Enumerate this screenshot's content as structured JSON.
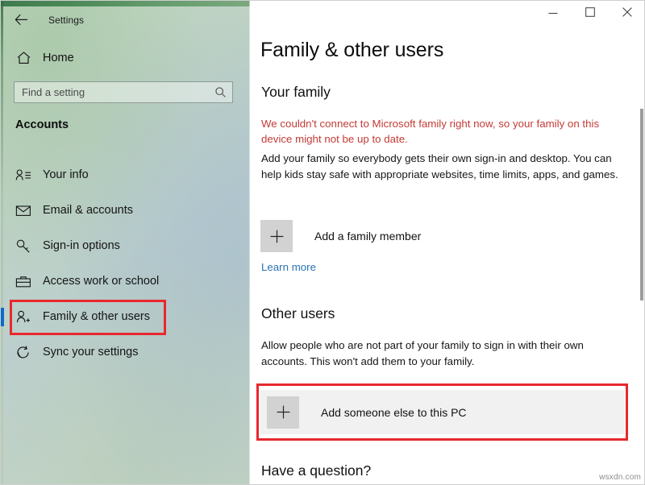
{
  "window": {
    "app_title": "Settings",
    "back_icon": "back-arrow-icon",
    "controls": {
      "minimize": "minimize-icon",
      "maximize": "maximize-icon",
      "close": "close-icon"
    }
  },
  "sidebar": {
    "home": {
      "label": "Home",
      "icon": "home-icon"
    },
    "search": {
      "placeholder": "Find a setting",
      "value": "",
      "icon": "search-icon"
    },
    "section_title": "Accounts",
    "items": [
      {
        "label": "Your info",
        "icon": "person-info-icon",
        "selected": false
      },
      {
        "label": "Email & accounts",
        "icon": "envelope-icon",
        "selected": false
      },
      {
        "label": "Sign-in options",
        "icon": "key-icon",
        "selected": false
      },
      {
        "label": "Access work or school",
        "icon": "briefcase-icon",
        "selected": false
      },
      {
        "label": "Family & other users",
        "icon": "person-add-icon",
        "selected": true
      },
      {
        "label": "Sync your settings",
        "icon": "sync-icon",
        "selected": false
      }
    ]
  },
  "main": {
    "page_title": "Family & other users",
    "your_family": {
      "heading": "Your family",
      "warning": "We couldn't connect to Microsoft family right now, so your family on this device might not be up to date.",
      "description": "Add your family so everybody gets their own sign-in and desktop. You can help kids stay safe with appropriate websites, time limits, apps, and games.",
      "add_button_label": "Add a family member",
      "add_button_icon": "plus-icon",
      "learn_more_label": "Learn more"
    },
    "other_users": {
      "heading": "Other users",
      "description": "Allow people who are not part of your family to sign in with their own accounts. This won't add them to your family.",
      "add_button_label": "Add someone else to this PC",
      "add_button_icon": "plus-icon"
    },
    "have_a_question_heading": "Have a question?"
  },
  "annotations": {
    "color": "#e8282d",
    "sidebar_target": "Family & other users",
    "main_target": "Add someone else to this PC"
  },
  "watermark": "wsxdn.com",
  "colors": {
    "accent_selection": "#0a6cc4",
    "warning_text": "#c23b36",
    "link": "#2a72b5",
    "plus_square": "#d2d2d2",
    "row_hover": "#f1f1f1"
  }
}
